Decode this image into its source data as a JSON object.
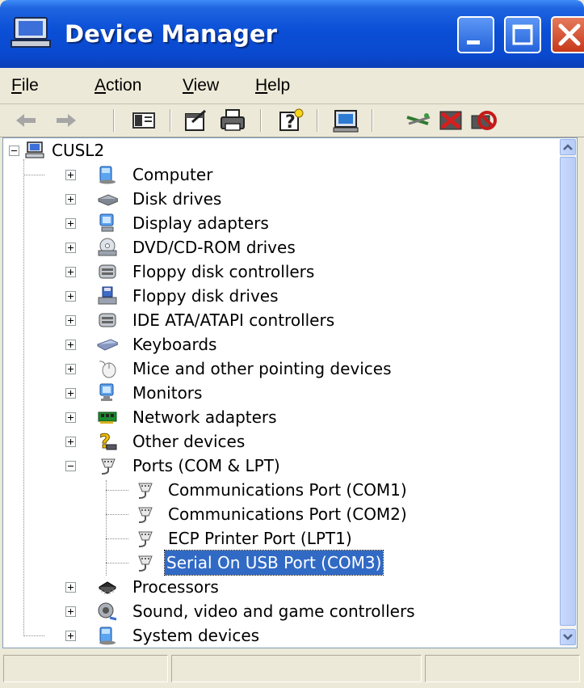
{
  "window": {
    "title": "Device Manager",
    "icon": "computer-icon",
    "controls": [
      "minimize-icon",
      "maximize-icon",
      "close-icon"
    ]
  },
  "menu": [
    {
      "accel": "F",
      "rest": "ile"
    },
    {
      "accel": "A",
      "rest": "ction"
    },
    {
      "accel": "V",
      "rest": "iew"
    },
    {
      "accel": "H",
      "rest": "elp"
    }
  ],
  "toolbar": [
    "back-arrow-icon",
    "forward-arrow-icon",
    "console-tree-icon",
    "properties-icon",
    "print-icon",
    "help-icon",
    "scan-hardware-icon",
    "update-driver-icon",
    "uninstall-icon",
    "disable-icon"
  ],
  "tree": {
    "root": "CUSL2",
    "categories": [
      {
        "label": "Computer",
        "icon": "computer-icon",
        "expanded": false
      },
      {
        "label": "Disk drives",
        "icon": "disk-drive-icon",
        "expanded": false
      },
      {
        "label": "Display adapters",
        "icon": "display-adapter-icon",
        "expanded": false
      },
      {
        "label": "DVD/CD-ROM drives",
        "icon": "cd-drive-icon",
        "expanded": false
      },
      {
        "label": "Floppy disk controllers",
        "icon": "controller-icon",
        "expanded": false
      },
      {
        "label": "Floppy disk drives",
        "icon": "floppy-drive-icon",
        "expanded": false
      },
      {
        "label": "IDE ATA/ATAPI controllers",
        "icon": "controller-icon",
        "expanded": false
      },
      {
        "label": "Keyboards",
        "icon": "keyboard-icon",
        "expanded": false
      },
      {
        "label": "Mice and other pointing devices",
        "icon": "mouse-icon",
        "expanded": false
      },
      {
        "label": "Monitors",
        "icon": "monitor-icon",
        "expanded": false
      },
      {
        "label": "Network adapters",
        "icon": "network-adapter-icon",
        "expanded": false
      },
      {
        "label": "Other devices",
        "icon": "unknown-device-icon",
        "expanded": false
      },
      {
        "label": "Ports (COM & LPT)",
        "icon": "port-icon",
        "expanded": true,
        "children": [
          {
            "label": "Communications Port (COM1)",
            "icon": "port-icon",
            "selected": false
          },
          {
            "label": "Communications Port (COM2)",
            "icon": "port-icon",
            "selected": false
          },
          {
            "label": "ECP Printer Port (LPT1)",
            "icon": "port-icon",
            "selected": false
          },
          {
            "label": "Serial On USB Port (COM3)",
            "icon": "port-icon",
            "selected": true
          }
        ]
      },
      {
        "label": "Processors",
        "icon": "processor-icon",
        "expanded": false
      },
      {
        "label": "Sound, video and game controllers",
        "icon": "sound-icon",
        "expanded": false
      },
      {
        "label": "System devices",
        "icon": "system-device-icon",
        "expanded": false
      }
    ]
  },
  "colors": {
    "title_bar": "#0A4FD6",
    "selection": "#316AC5",
    "window_face": "#ECE9D8",
    "close_button": "#C7391A"
  }
}
